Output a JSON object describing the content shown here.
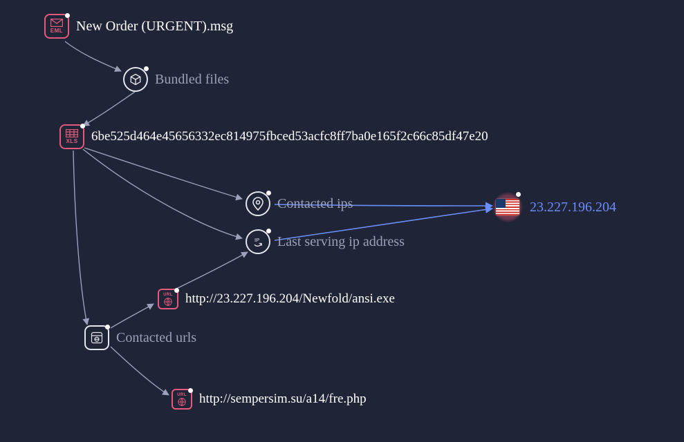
{
  "nodes": {
    "eml": {
      "label": "New Order  (URGENT).msg",
      "ext": "EML"
    },
    "bundled": {
      "label": "Bundled files"
    },
    "xls": {
      "label": "6be525d464e45656332ec814975fbced53acfc8ff7ba0e165f2c66c85df47e20",
      "ext": "XLS"
    },
    "contacted_ips": {
      "label": "Contacted ips"
    },
    "last_ip": {
      "label": "Last serving ip address"
    },
    "ip": {
      "label": "23.227.196.204",
      "country": "US"
    },
    "url1": {
      "label": "http://23.227.196.204/Newfold/ansi.exe",
      "ext": "URL"
    },
    "contacted_urls": {
      "label": "Contacted urls"
    },
    "url2": {
      "label": "http://sempersim.su/a14/fre.php",
      "ext": "URL"
    }
  },
  "chart_data": {
    "type": "graph",
    "title": "",
    "nodes": [
      {
        "id": "eml",
        "label": "New Order  (URGENT).msg",
        "kind": "email-file"
      },
      {
        "id": "bundled",
        "label": "Bundled files",
        "kind": "relation"
      },
      {
        "id": "xls",
        "label": "6be525d464e45656332ec814975fbced53acfc8ff7ba0e165f2c66c85df47e20",
        "kind": "xls-file"
      },
      {
        "id": "contacted_ips",
        "label": "Contacted ips",
        "kind": "relation"
      },
      {
        "id": "last_ip",
        "label": "Last serving ip address",
        "kind": "relation"
      },
      {
        "id": "ip",
        "label": "23.227.196.204",
        "kind": "ip-address",
        "country": "US"
      },
      {
        "id": "contacted_urls",
        "label": "Contacted urls",
        "kind": "relation"
      },
      {
        "id": "url1",
        "label": "http://23.227.196.204/Newfold/ansi.exe",
        "kind": "url"
      },
      {
        "id": "url2",
        "label": "http://sempersim.su/a14/fre.php",
        "kind": "url"
      }
    ],
    "edges": [
      {
        "from": "eml",
        "to": "bundled"
      },
      {
        "from": "bundled",
        "to": "xls"
      },
      {
        "from": "xls",
        "to": "contacted_ips"
      },
      {
        "from": "contacted_ips",
        "to": "ip",
        "highlight": true
      },
      {
        "from": "xls",
        "to": "last_ip"
      },
      {
        "from": "last_ip",
        "to": "ip",
        "highlight": true
      },
      {
        "from": "xls",
        "to": "contacted_urls"
      },
      {
        "from": "contacted_urls",
        "to": "url1"
      },
      {
        "from": "url1",
        "to": "last_ip"
      },
      {
        "from": "contacted_urls",
        "to": "url2"
      }
    ]
  }
}
